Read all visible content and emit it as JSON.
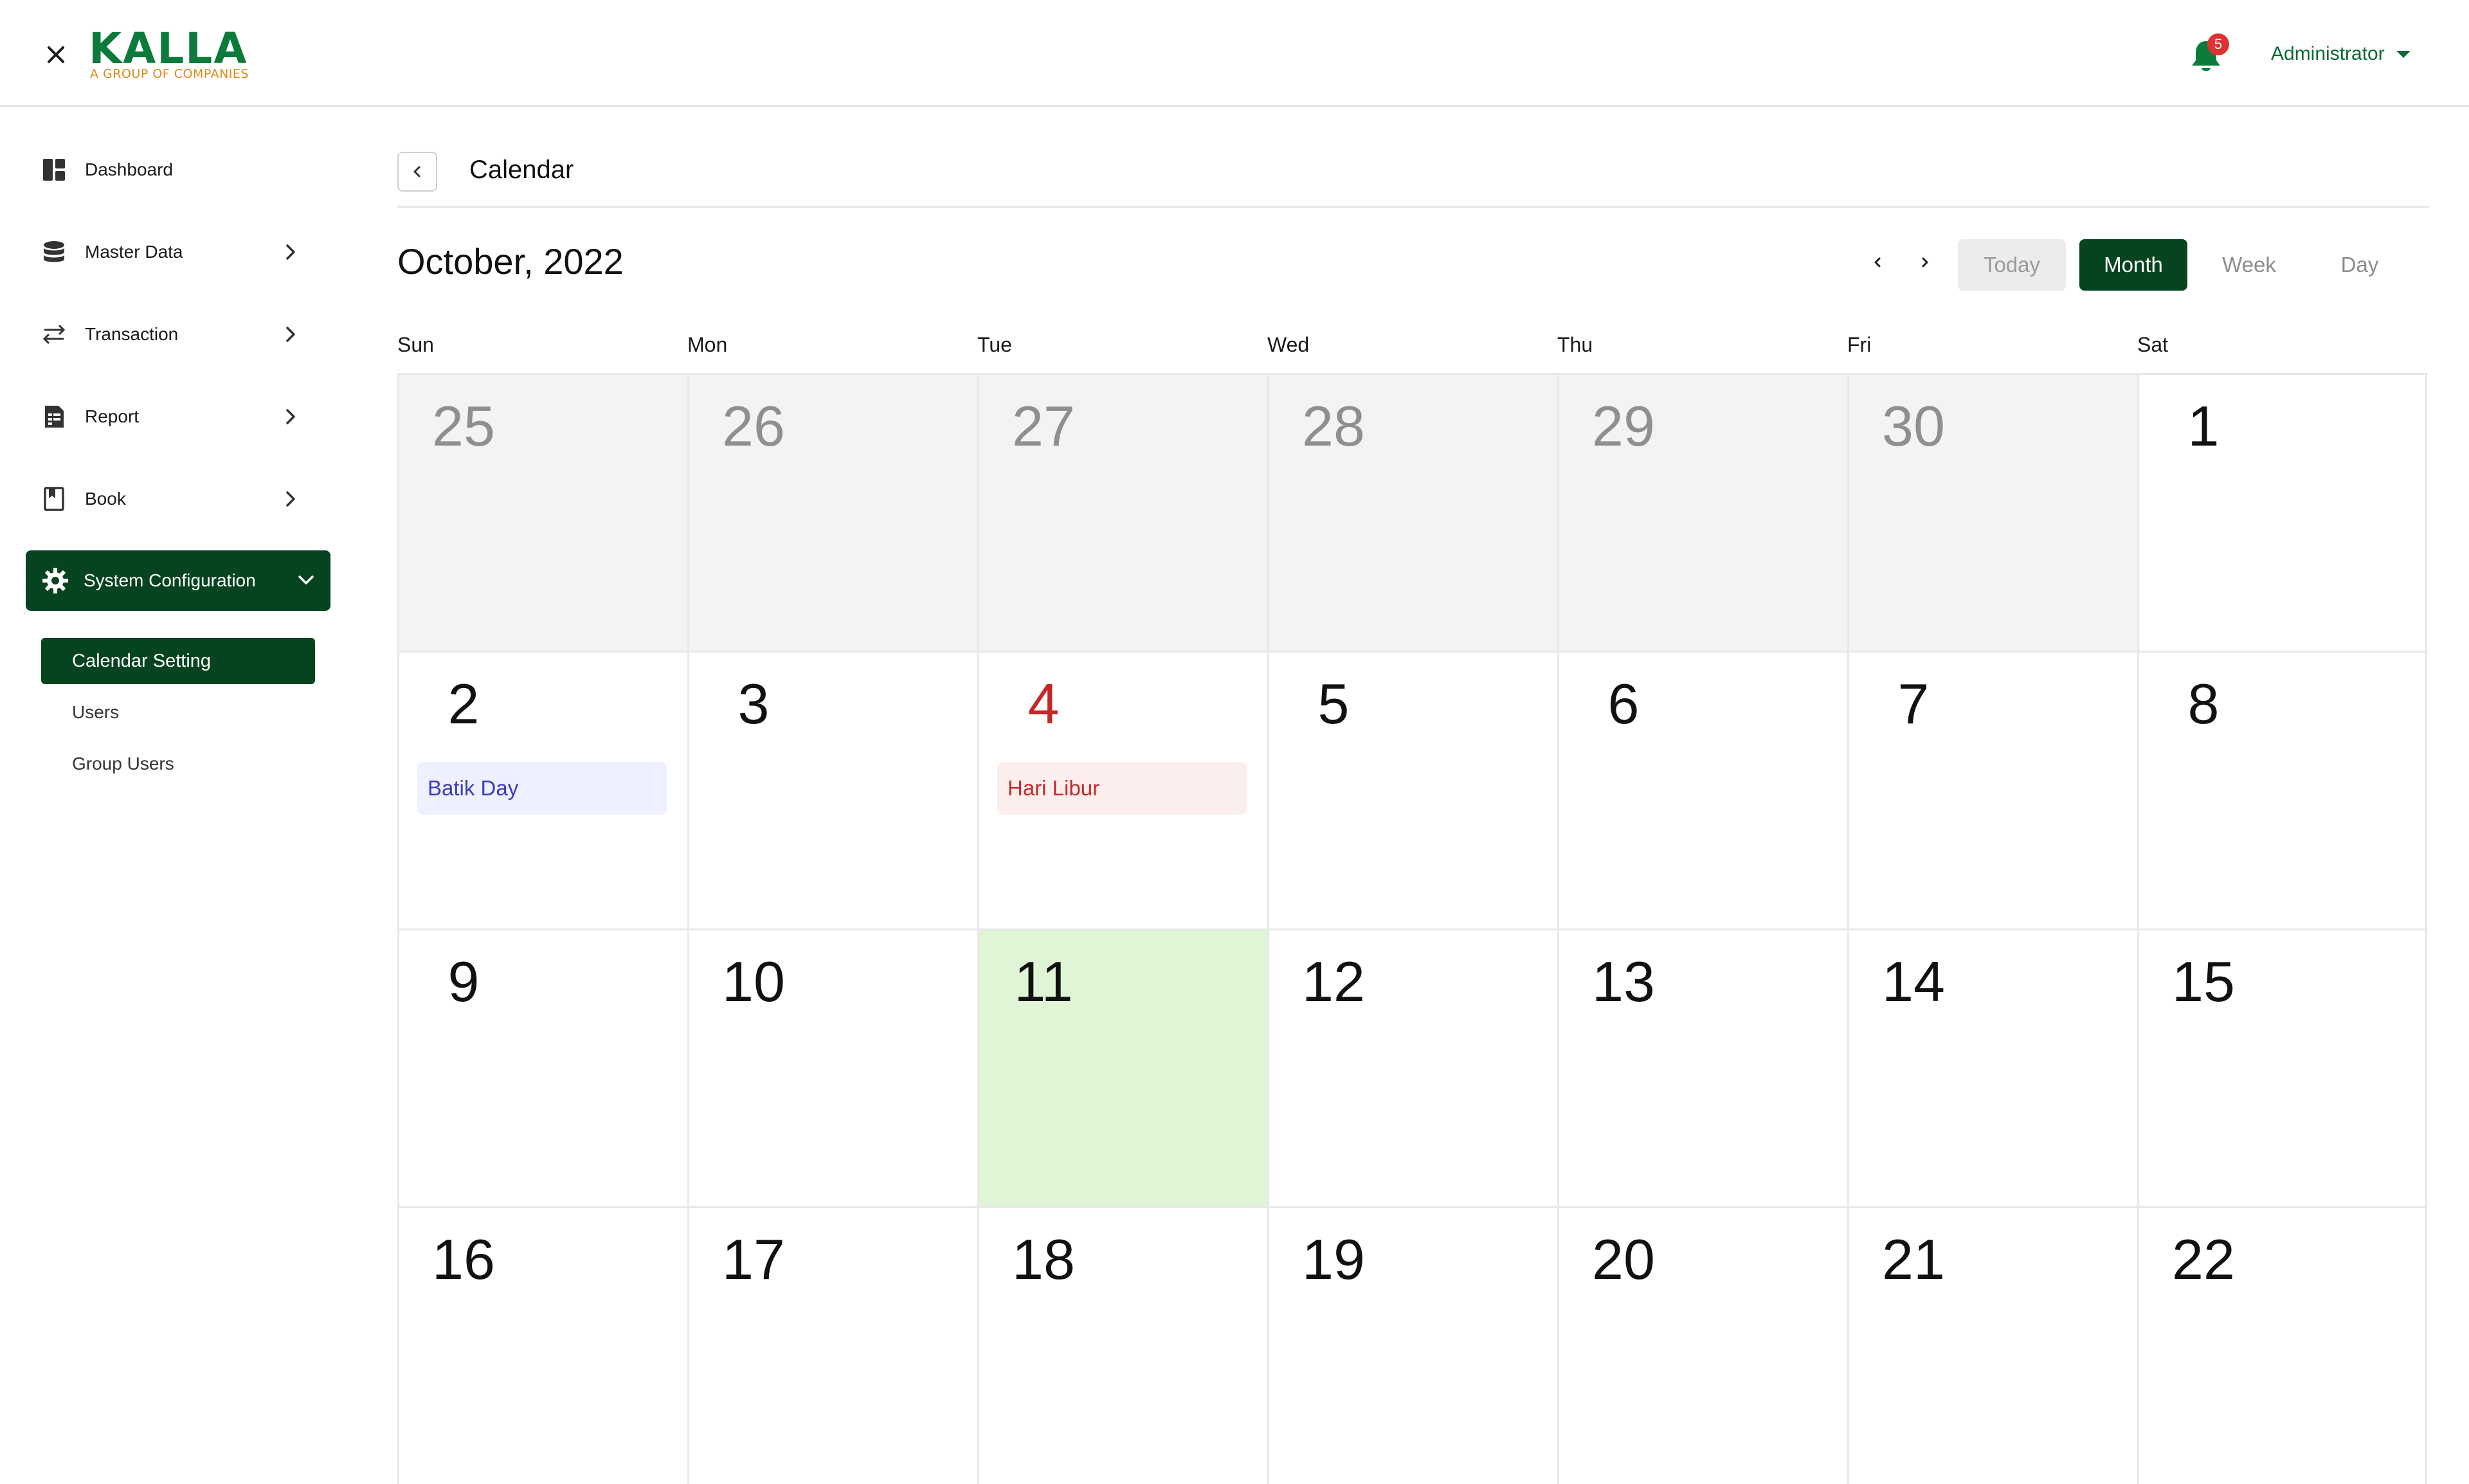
{
  "header": {
    "logo_text": "KALLA",
    "logo_tagline": "A GROUP OF COMPANIES",
    "notification_count": "5",
    "user_name": "Administrator"
  },
  "sidebar": {
    "items": [
      {
        "label": "Dashboard",
        "icon": "dashboard-icon"
      },
      {
        "label": "Master Data",
        "icon": "database-icon"
      },
      {
        "label": "Transaction",
        "icon": "transfer-icon"
      },
      {
        "label": "Report",
        "icon": "report-icon"
      },
      {
        "label": "Book",
        "icon": "book-icon"
      },
      {
        "label": "System Configuration",
        "icon": "gear-icon"
      }
    ],
    "subitems": [
      {
        "label": "Calendar Setting"
      },
      {
        "label": "Users"
      },
      {
        "label": "Group Users"
      }
    ]
  },
  "page": {
    "title": "Calendar",
    "month_label": "October, 2022"
  },
  "views": {
    "today": "Today",
    "month": "Month",
    "week": "Week",
    "day": "Day"
  },
  "weekdays": [
    "Sun",
    "Mon",
    "Tue",
    "Wed",
    "Thu",
    "Fri",
    "Sat"
  ],
  "weeks": [
    [
      {
        "day": "25",
        "out": true
      },
      {
        "day": "26",
        "out": true
      },
      {
        "day": "27",
        "out": true
      },
      {
        "day": "28",
        "out": true
      },
      {
        "day": "29",
        "out": true
      },
      {
        "day": "30",
        "out": true
      },
      {
        "day": "1"
      }
    ],
    [
      {
        "day": "2",
        "event": "Batik Day",
        "event_color": "blue"
      },
      {
        "day": "3"
      },
      {
        "day": "4",
        "red": true,
        "event": "Hari Libur",
        "event_color": "red"
      },
      {
        "day": "5"
      },
      {
        "day": "6"
      },
      {
        "day": "7"
      },
      {
        "day": "8"
      }
    ],
    [
      {
        "day": "9"
      },
      {
        "day": "10"
      },
      {
        "day": "11",
        "today": true
      },
      {
        "day": "12"
      },
      {
        "day": "13"
      },
      {
        "day": "14"
      },
      {
        "day": "15"
      }
    ],
    [
      {
        "day": "16"
      },
      {
        "day": "17"
      },
      {
        "day": "18"
      },
      {
        "day": "19"
      },
      {
        "day": "20"
      },
      {
        "day": "21"
      },
      {
        "day": "22"
      }
    ]
  ],
  "colors": {
    "brand_green": "#064420",
    "accent_green": "#0b7a3a",
    "today_bg": "#dff5d5",
    "holiday_red": "#c62828"
  }
}
